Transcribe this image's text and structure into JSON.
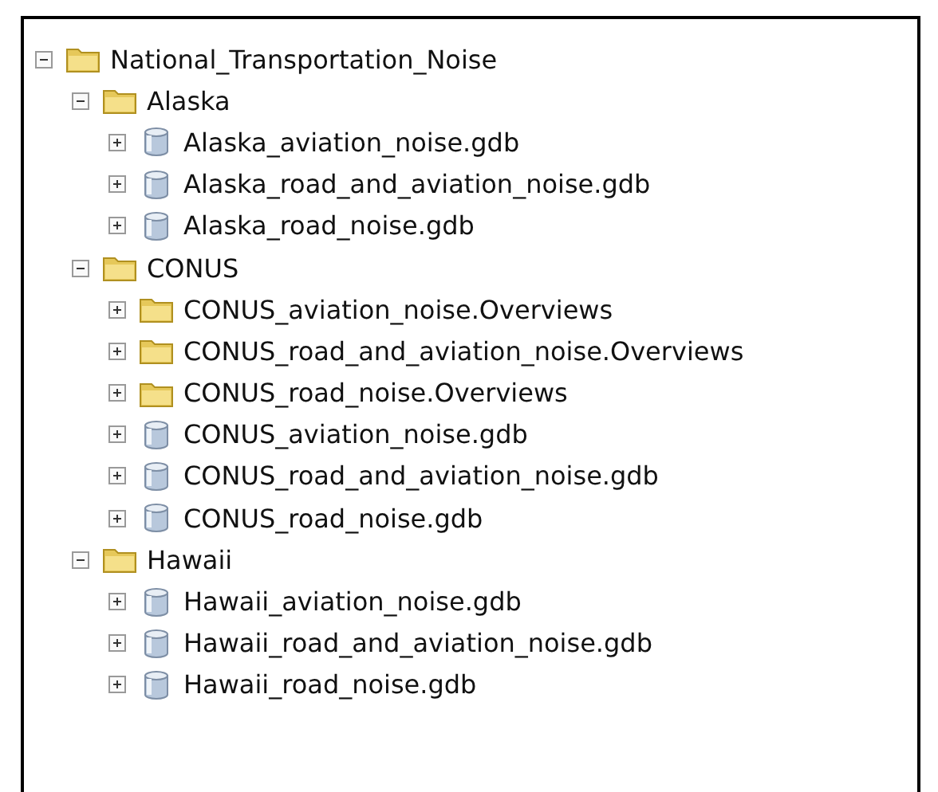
{
  "tree": [
    {
      "label": "National_Transportation_Noise",
      "kind": "folder",
      "expanded": true,
      "children": [
        {
          "label": "Alaska",
          "kind": "folder",
          "expanded": true,
          "children": [
            {
              "label": "Alaska_aviation_noise.gdb",
              "kind": "database",
              "expanded": false
            },
            {
              "label": "Alaska_road_and_aviation_noise.gdb",
              "kind": "database",
              "expanded": false
            },
            {
              "label": "Alaska_road_noise.gdb",
              "kind": "database",
              "expanded": false
            }
          ]
        },
        {
          "label": "CONUS",
          "kind": "folder",
          "expanded": true,
          "children": [
            {
              "label": "CONUS_aviation_noise.Overviews",
              "kind": "folder",
              "expanded": false
            },
            {
              "label": "CONUS_road_and_aviation_noise.Overviews",
              "kind": "folder",
              "expanded": false
            },
            {
              "label": "CONUS_road_noise.Overviews",
              "kind": "folder",
              "expanded": false
            },
            {
              "label": "CONUS_aviation_noise.gdb",
              "kind": "database",
              "expanded": false
            },
            {
              "label": "CONUS_road_and_aviation_noise.gdb",
              "kind": "database",
              "expanded": false
            },
            {
              "label": "CONUS_road_noise.gdb",
              "kind": "database",
              "expanded": false
            }
          ]
        },
        {
          "label": "Hawaii",
          "kind": "folder",
          "expanded": true,
          "children": [
            {
              "label": "Hawaii_aviation_noise.gdb",
              "kind": "database",
              "expanded": false
            },
            {
              "label": "Hawaii_road_and_aviation_noise.gdb",
              "kind": "database",
              "expanded": false
            },
            {
              "label": "Hawaii_road_noise.gdb",
              "kind": "database",
              "expanded": false
            }
          ]
        }
      ]
    }
  ]
}
